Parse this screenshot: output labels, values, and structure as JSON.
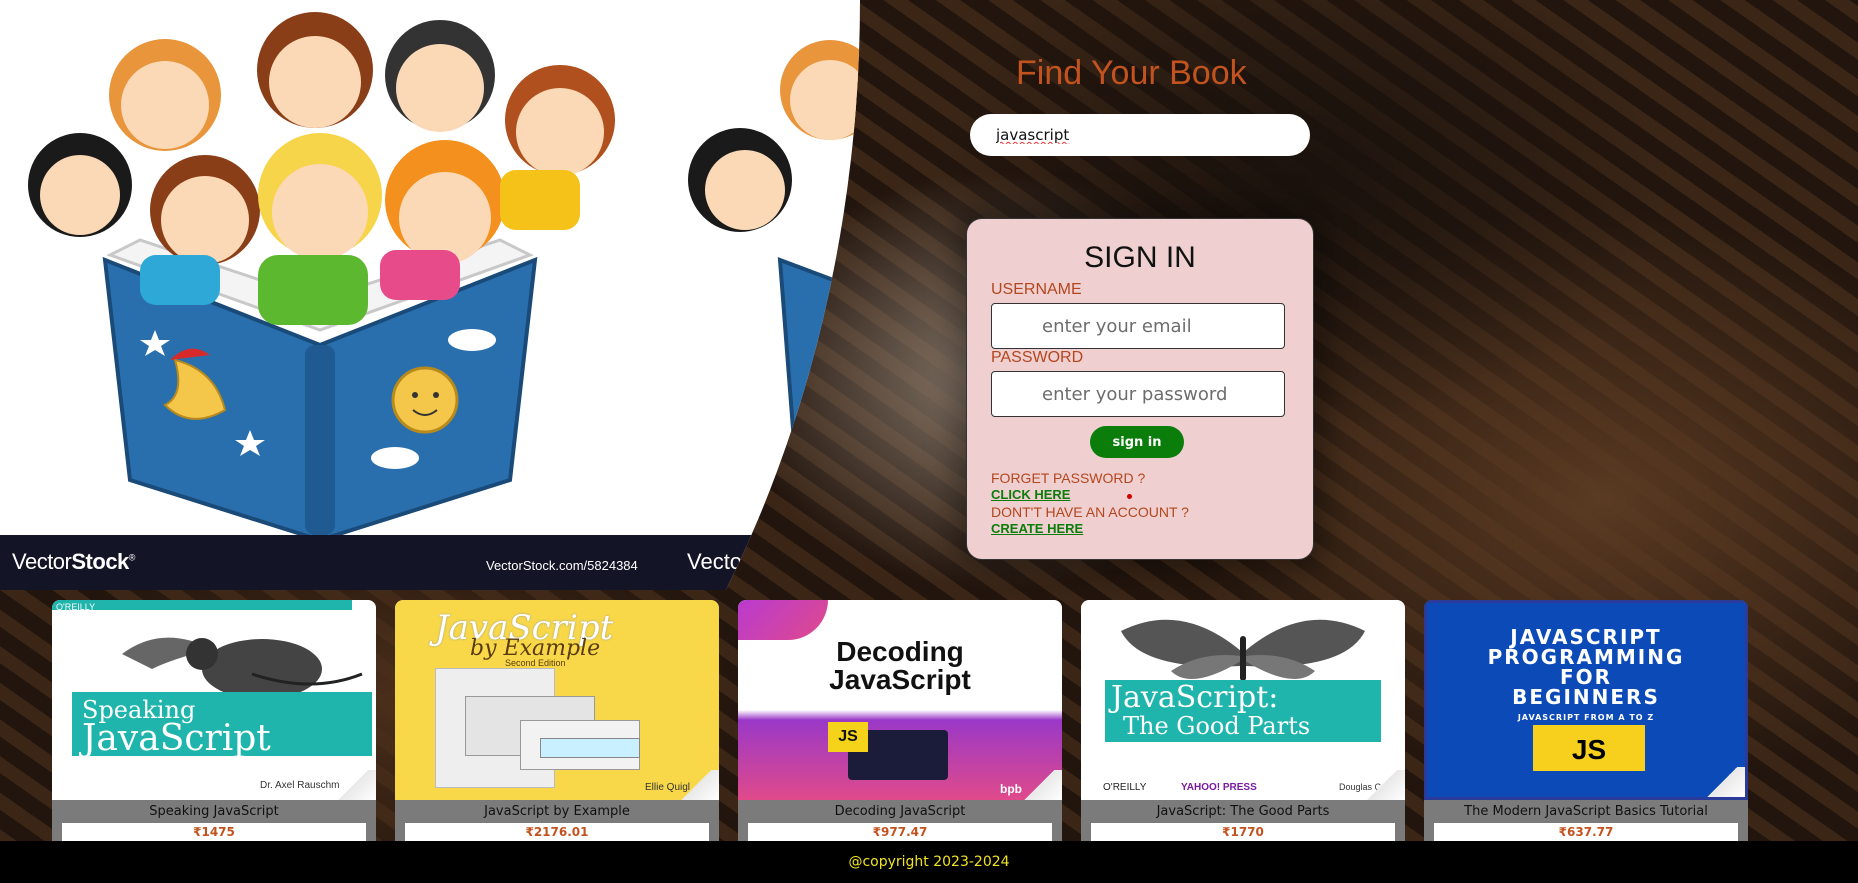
{
  "hero": {
    "brand": "Vector",
    "brand_bold": "Stock",
    "brand_mark": "®",
    "url": "VectorStock.com/5824384",
    "brand_repeat": "VectorSt"
  },
  "search": {
    "title": "Find Your Book",
    "value": "javascript"
  },
  "signin": {
    "heading": "SIGN IN",
    "username_label": "USERNAME",
    "username_placeholder": "enter your email",
    "password_label": "PASSWORD",
    "password_placeholder": "enter your password",
    "button_label": "sign in",
    "forgot_text": "FORGET PASSWORD ?",
    "forgot_link": "CLICK HERE",
    "signup_text": "DONT'T HAVE AN ACCOUNT ?",
    "signup_link": "CREATE HERE"
  },
  "books": [
    {
      "title": "Speaking JavaScript",
      "price": "₹1475",
      "cover_text": [
        "O'REILLY",
        "Speaking",
        "JavaScript",
        "Dr. Axel Rauschm"
      ]
    },
    {
      "title": "JavaScript by Example",
      "price": "₹2176.01",
      "cover_text": [
        "JavaScript",
        "by Example",
        "Second Edition",
        "Ellie Quigl"
      ]
    },
    {
      "title": "Decoding JavaScript",
      "price": "₹977.47",
      "cover_text": [
        "Decoding",
        "JavaScript",
        "JS",
        "bpb"
      ]
    },
    {
      "title": "JavaScript: The Good Parts",
      "price": "₹1770",
      "cover_text": [
        "JavaScript:",
        "The Good Parts",
        "O'REILLY",
        "YAHOO! PRESS",
        "Douglas C"
      ]
    },
    {
      "title": "The Modern JavaScript Basics Tutorial",
      "price": "₹637.77",
      "cover_text": [
        "JAVASCRIPT",
        "PROGRAMMING",
        "FOR",
        "BEGINNERS",
        "JAVASCRIPT FROM A TO Z",
        "JS"
      ]
    }
  ],
  "footer": {
    "copyright": "@copyright 2023-2024"
  },
  "colors": {
    "accent_orange": "#c2531f",
    "signin_bg": "#efcfd0",
    "button_green": "#0b7d0b",
    "footer_text": "#f0e422"
  }
}
